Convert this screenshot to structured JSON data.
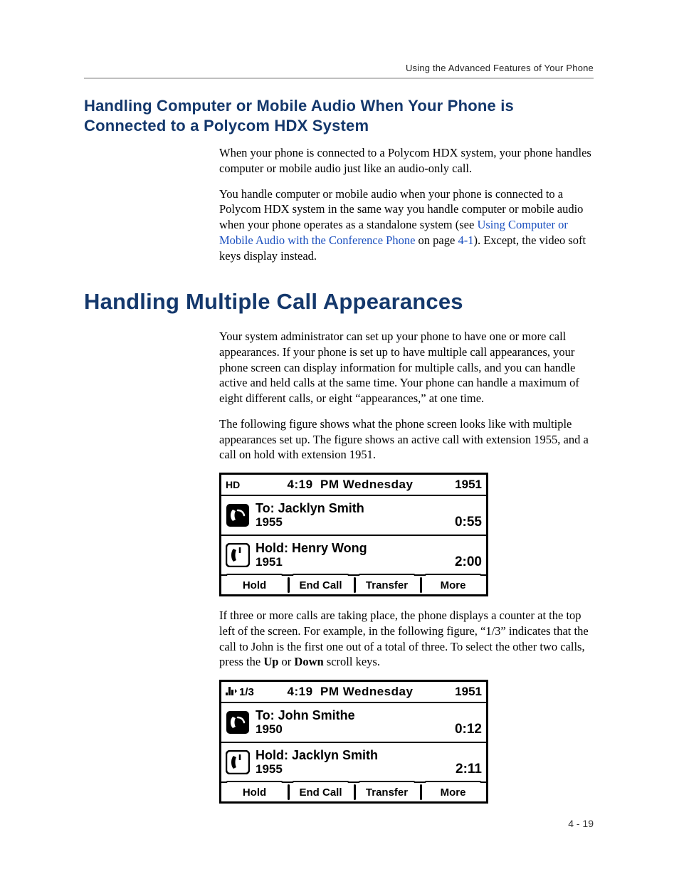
{
  "running_head": "Using the Advanced Features of Your Phone",
  "heading_hdx": "Handling Computer or Mobile Audio When Your Phone is Connected to a Polycom HDX System",
  "hdx_p1": "When your phone is connected to a Polycom HDX system, your phone handles computer or mobile audio just like an audio-only call.",
  "hdx_p2_a": "You handle computer or mobile audio when your phone is connected to a Polycom HDX system in the same way you handle computer or mobile audio when your phone operates as a standalone system (see ",
  "hdx_link": "Using Computer or Mobile Audio with the Conference Phone",
  "hdx_p2_b": " on page ",
  "hdx_pageref": "4-1",
  "hdx_p2_c": "). Except, the video soft keys display instead.",
  "heading_multi": "Handling Multiple Call Appearances",
  "multi_p1": "Your system administrator can set up your phone to have one or more call appearances. If your phone is set up to have multiple call appearances, your phone screen can display information for multiple calls, and you can handle active and held calls at the same time. Your phone can handle a maximum of eight different calls, or eight “appearances,” at one time.",
  "multi_p2": "The following figure shows what the phone screen looks like with multiple appearances set up. The figure shows an active call with extension 1955, and a call on hold with extension 1951.",
  "multi_p3_a": "If three or more calls are taking place, the phone displays a counter at the top left of the screen. For example, in the following figure, “1/3” indicates that the call to John is the first one out of a total of three. To select the other two calls, press the ",
  "multi_p3_up": "Up",
  "multi_p3_or": " or ",
  "multi_p3_down": "Down",
  "multi_p3_b": " scroll keys.",
  "fig1": {
    "hd_label": "HD",
    "time": "4:19",
    "ampm": "PM",
    "day": "Wednesday",
    "ext": "1951",
    "calls": [
      {
        "icon": "handset-active-icon",
        "line1": "To: Jacklyn Smith",
        "line2": "1955",
        "duration": "0:55"
      },
      {
        "icon": "handset-hold-icon",
        "line1": "Hold: Henry Wong",
        "line2": "1951",
        "duration": "2:00"
      }
    ],
    "softkeys": [
      "Hold",
      "End Call",
      "Transfer",
      "More"
    ]
  },
  "fig2": {
    "counter": "1/3",
    "time": "4:19",
    "ampm": "PM",
    "day": "Wednesday",
    "ext": "1951",
    "calls": [
      {
        "icon": "handset-active-icon",
        "line1": "To: John Smithe",
        "line2": "1950",
        "duration": "0:12"
      },
      {
        "icon": "handset-hold-icon",
        "line1": "Hold: Jacklyn Smith",
        "line2": "1955",
        "duration": "2:11"
      }
    ],
    "softkeys": [
      "Hold",
      "End Call",
      "Transfer",
      "More"
    ]
  },
  "page_number": "4 - 19"
}
